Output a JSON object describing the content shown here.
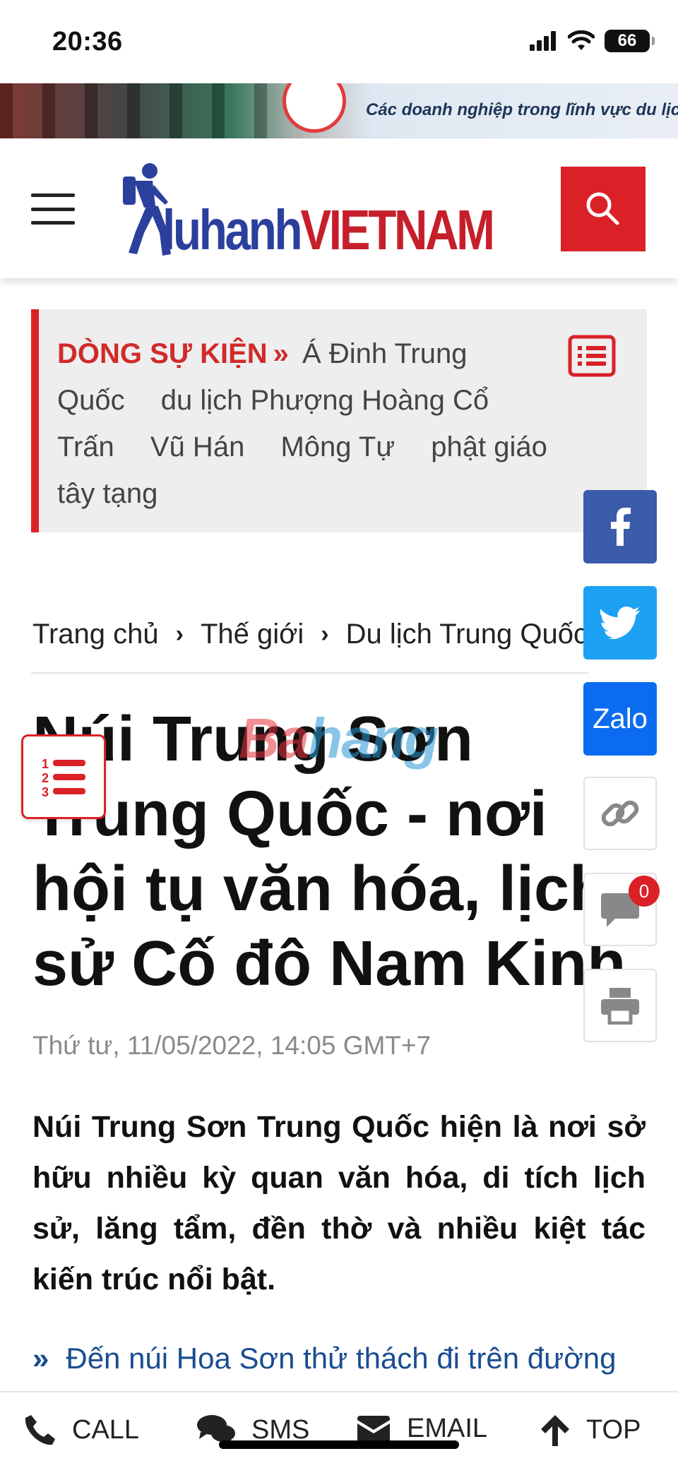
{
  "status_bar": {
    "time": "20:36",
    "battery": "66"
  },
  "ad": {
    "text": "Các doanh nghiệp trong lĩnh vực du lịch"
  },
  "header": {
    "logo_part1": "luhanh",
    "logo_part2": "VIETNAM"
  },
  "events": {
    "label": "DÒNG SỰ KIỆN",
    "chevron": "»",
    "tags": [
      "Á Đinh Trung Quốc",
      "du lịch Phượng Hoàng Cổ Trấn",
      "Vũ Hán",
      "Mông Tự",
      "phật giáo tây tạng"
    ]
  },
  "social": {
    "zalo": "Zalo",
    "comment_count": "0"
  },
  "breadcrumb": {
    "items": [
      "Trang chủ",
      "Thế giới",
      "Du lịch Trung Quốc"
    ],
    "separator": "›"
  },
  "article": {
    "title": "Núi Trung Sơn Trung Quốc - nơi hội tụ văn hóa, lịch sử Cố đô Nam Kinh",
    "watermark_a": "Ba",
    "watermark_b": "hang",
    "date": "Thứ tư, 11/05/2022, 14:05 GMT+7",
    "lead": "Núi Trung Sơn Trung Quốc hiện là nơi sở hữu nhiều kỳ quan văn hóa, di tích lịch sử, lăng tẩm, đền thờ và nhiều kiệt tác kiến trúc nổi bật.",
    "related_arrow": "»",
    "related": "Đến núi Hoa Sơn thử thách đi trên đường"
  },
  "bottom_bar": {
    "call": "CALL",
    "sms": "SMS",
    "email": "EMAIL",
    "top": "TOP"
  },
  "colors": {
    "brand_red": "#da2128",
    "brand_blue": "#2b3f9c",
    "facebook": "#3b5bab",
    "twitter": "#1da1f2",
    "zalo": "#0b6cf1",
    "link": "#1a4d91"
  }
}
